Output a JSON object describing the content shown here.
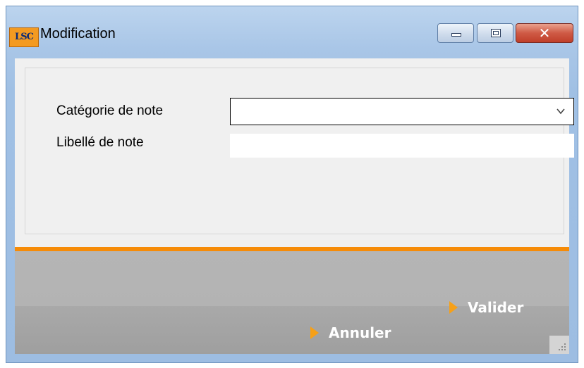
{
  "window": {
    "title": "Modification",
    "icon_text": "LSC",
    "controls": {
      "minimize": "minimize-icon",
      "maximize": "maximize-icon",
      "close": "close-icon",
      "close_glyph": "✕"
    }
  },
  "form": {
    "categorie_label": "Catégorie de note",
    "categorie_value": "",
    "libelle_label": "Libellé de note",
    "libelle_value": ""
  },
  "actions": {
    "valider_label": "Valider",
    "annuler_label": "Annuler"
  },
  "colors": {
    "accent_orange": "#f68b07",
    "arrow_orange": "#f6a018",
    "titlebar_blue": "#a9c6e7",
    "close_red": "#c03f2a"
  }
}
